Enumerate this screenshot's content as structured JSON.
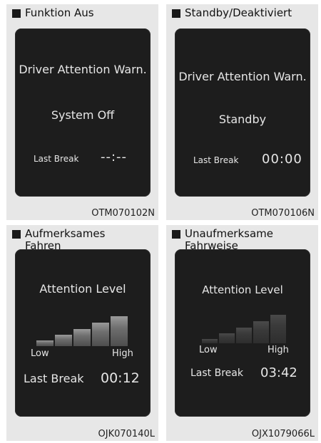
{
  "panels": [
    {
      "caption": "Funktion Aus",
      "title": "Driver Attention Warn.",
      "state": "System Off",
      "last_break_label": "Last Break",
      "last_break_value": "--:--",
      "code": "OTM070102N"
    },
    {
      "caption": "Standby/Deaktiviert",
      "title": "Driver Attention Warn.",
      "state": "Standby",
      "last_break_label": "Last Break",
      "last_break_value": "00:00",
      "code": "OTM070106N"
    },
    {
      "caption": "Aufmerksames\nFahren",
      "title": "Attention Level",
      "low_label": "Low",
      "high_label": "High",
      "level": 5,
      "last_break_label": "Last Break",
      "last_break_value": "00:12",
      "code": "OJK070140L"
    },
    {
      "caption": "Unaufmerksame\nFahrweise",
      "title": "Attention Level",
      "low_label": "Low",
      "high_label": "High",
      "level": 0,
      "last_break_label": "Last Break",
      "last_break_value": "03:42",
      "code": "OJX1079066L"
    }
  ]
}
